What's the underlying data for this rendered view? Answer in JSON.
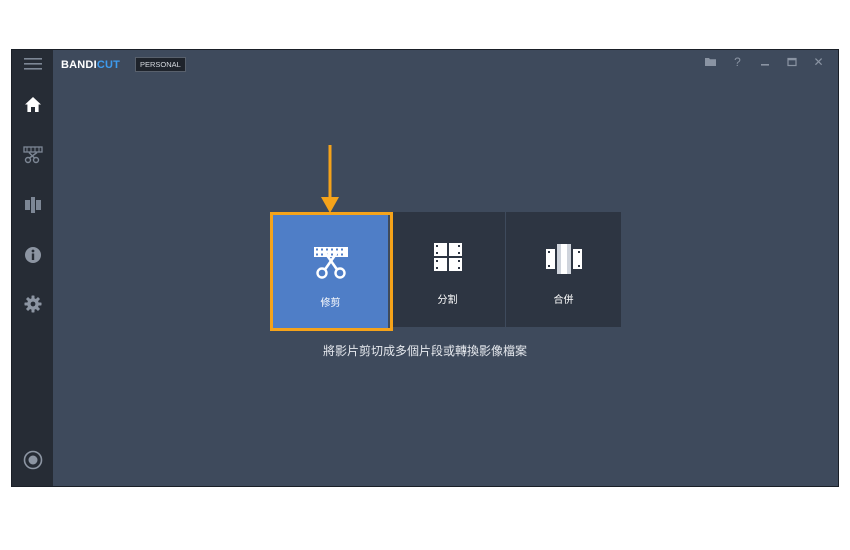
{
  "app": {
    "logo_main": "BANDI",
    "logo_accent": "CUT",
    "edition": "PERSONAL"
  },
  "sidebar": {
    "items": [
      {
        "icon": "menu-icon"
      },
      {
        "icon": "home-icon",
        "active": true
      },
      {
        "icon": "trim-icon"
      },
      {
        "icon": "split-icon"
      },
      {
        "icon": "info-icon"
      },
      {
        "icon": "settings-icon"
      },
      {
        "icon": "record-icon"
      }
    ]
  },
  "titlebar": {
    "controls": [
      "folder-icon",
      "help-icon",
      "minimize-icon",
      "maximize-icon",
      "close-icon"
    ],
    "help_label": "?",
    "close_label": "✕"
  },
  "main": {
    "tiles": [
      {
        "label": "修剪",
        "icon": "scissors-film-icon",
        "active": true
      },
      {
        "label": "分割",
        "icon": "split-film-icon",
        "active": false
      },
      {
        "label": "合併",
        "icon": "join-film-icon",
        "active": false
      }
    ],
    "description": "將影片剪切成多個片段或轉換影像檔案"
  },
  "colors": {
    "window_bg": "#3e4a5c",
    "sidebar_bg": "#262c35",
    "tile_bg": "#2d3542",
    "tile_active": "#4f7ec7",
    "highlight": "#f5a31a",
    "accent": "#3d9cf0"
  }
}
